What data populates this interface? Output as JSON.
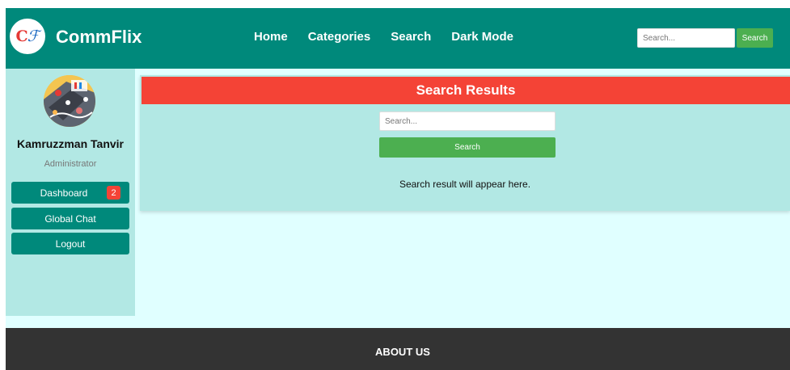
{
  "header": {
    "brand": "CommFlix",
    "logo_text_c": "C",
    "logo_text_f": "ℱ",
    "nav": [
      "Home",
      "Categories",
      "Search",
      "Dark Mode"
    ],
    "search_placeholder": "Search...",
    "search_button": "Search"
  },
  "sidebar": {
    "user_name": "Kamruzzman Tanvir",
    "user_role": "Administrator",
    "items": [
      {
        "label": "Dashboard",
        "badge": "2"
      },
      {
        "label": "Global Chat"
      },
      {
        "label": "Logout"
      }
    ]
  },
  "main": {
    "title": "Search Results",
    "search_placeholder": "Search...",
    "search_button": "Search",
    "result_message": "Search result will appear here."
  },
  "footer": {
    "title": "ABOUT US"
  },
  "colors": {
    "header": "#00897b",
    "panel": "#b2e8e4",
    "title_bar": "#f44336",
    "button": "#4caf50",
    "footer": "#333333",
    "background": "#e0ffff"
  }
}
